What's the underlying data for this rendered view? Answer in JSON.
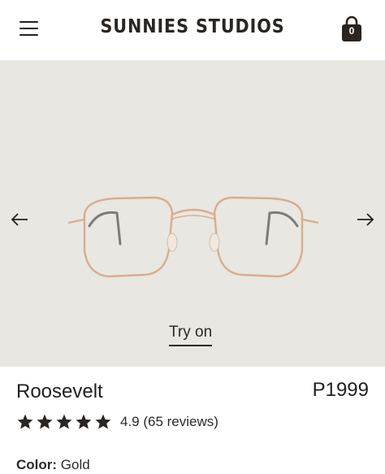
{
  "header": {
    "brand": "SUNNIES STUDIOS",
    "cart_count": "0",
    "menu_icon": "hamburger-menu-icon",
    "cart_icon": "shopping-bag-icon"
  },
  "gallery": {
    "prev_icon": "arrow-left-icon",
    "next_icon": "arrow-right-icon",
    "try_on_label": "Try on",
    "background_color": "#e8e7e2",
    "frame_color": "#d9ad8c"
  },
  "product": {
    "name": "Roosevelt",
    "price": "P1999",
    "rating_value": 4.9,
    "rating_max": 5,
    "rating_text": "4.9 (65 reviews)",
    "color_label": "Color:",
    "color_value": "Gold"
  },
  "colors": {
    "text": "#1f1f1f",
    "star": "#2a2623"
  }
}
